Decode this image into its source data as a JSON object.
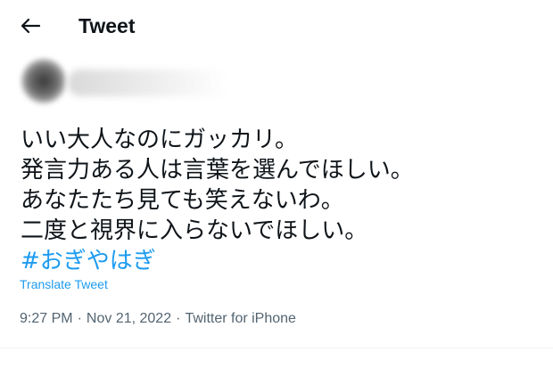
{
  "header": {
    "back_icon": "arrow-left-icon",
    "title": "Tweet"
  },
  "tweet": {
    "lines": [
      "いい大人なのにガッカリ。",
      "発言力ある人は言葉を選んでほしい。",
      "あなたたち見ても笑えないわ。",
      "二度と視界に入らないでほしい。"
    ],
    "hashtag": "#おぎやはぎ",
    "translate_label": "Translate Tweet",
    "time": "9:27 PM",
    "separator": "·",
    "date": "Nov 21, 2022",
    "source": "Twitter for iPhone"
  },
  "colors": {
    "link": "#1d9bf0",
    "text": "#0f1419",
    "muted": "#536471"
  }
}
